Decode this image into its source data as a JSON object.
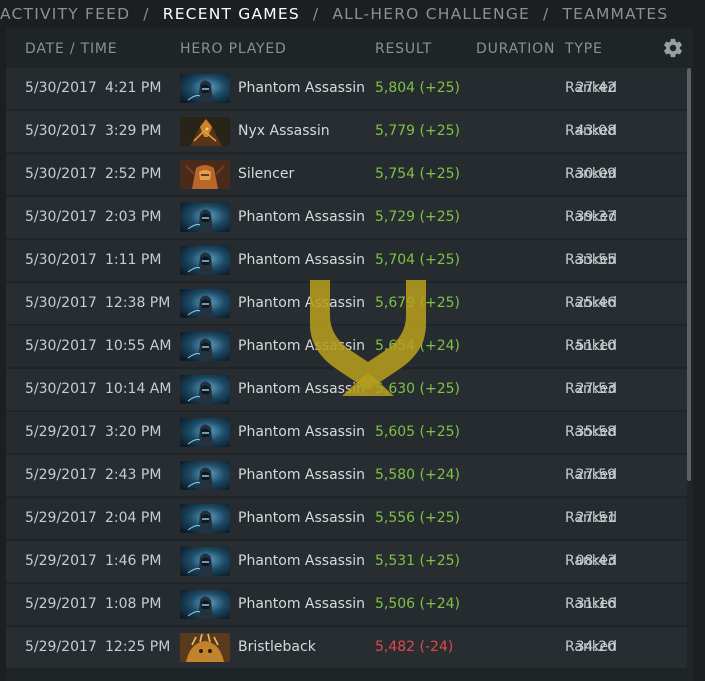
{
  "nav": {
    "tabs": [
      {
        "label": "Activity Feed",
        "active": false
      },
      {
        "label": "Recent Games",
        "active": true
      },
      {
        "label": "All-Hero Challenge",
        "active": false
      },
      {
        "label": "Teammates",
        "active": false
      }
    ],
    "separator": "/"
  },
  "header": {
    "date_time": "DATE / TIME",
    "hero": "HERO PLAYED",
    "result": "RESULT",
    "duration": "DURATION",
    "type": "TYPE",
    "settings_icon": "gear-icon"
  },
  "colors": {
    "win": "#7fc244",
    "loss": "#e04848",
    "watermark": "#b59d1e"
  },
  "games": [
    {
      "date": "5/30/2017",
      "time": "4:21 PM",
      "hero": "Phantom Assassin",
      "icon": "phantom-assassin",
      "result": "5,804 (+25)",
      "outcome": "win",
      "duration": "27:42",
      "type": "Ranked"
    },
    {
      "date": "5/30/2017",
      "time": "3:29 PM",
      "hero": "Nyx Assassin",
      "icon": "nyx-assassin",
      "result": "5,779 (+25)",
      "outcome": "win",
      "duration": "43:08",
      "type": "Ranked"
    },
    {
      "date": "5/30/2017",
      "time": "2:52 PM",
      "hero": "Silencer",
      "icon": "silencer",
      "result": "5,754 (+25)",
      "outcome": "win",
      "duration": "30:09",
      "type": "Ranked"
    },
    {
      "date": "5/30/2017",
      "time": "2:03 PM",
      "hero": "Phantom Assassin",
      "icon": "phantom-assassin",
      "result": "5,729 (+25)",
      "outcome": "win",
      "duration": "39:37",
      "type": "Ranked"
    },
    {
      "date": "5/30/2017",
      "time": "1:11 PM",
      "hero": "Phantom Assassin",
      "icon": "phantom-assassin",
      "result": "5,704 (+25)",
      "outcome": "win",
      "duration": "33:55",
      "type": "Ranked"
    },
    {
      "date": "5/30/2017",
      "time": "12:38 PM",
      "hero": "Phantom Assassin",
      "icon": "phantom-assassin",
      "result": "5,679 (+25)",
      "outcome": "win",
      "duration": "25:46",
      "type": "Ranked"
    },
    {
      "date": "5/30/2017",
      "time": "10:55 AM",
      "hero": "Phantom Assassin",
      "icon": "phantom-assassin",
      "result": "5,654 (+24)",
      "outcome": "win",
      "duration": "51:10",
      "type": "Ranked"
    },
    {
      "date": "5/30/2017",
      "time": "10:14 AM",
      "hero": "Phantom Assassin",
      "icon": "phantom-assassin",
      "result": "5,630 (+25)",
      "outcome": "win",
      "duration": "27:53",
      "type": "Ranked"
    },
    {
      "date": "5/29/2017",
      "time": "3:20 PM",
      "hero": "Phantom Assassin",
      "icon": "phantom-assassin",
      "result": "5,605 (+25)",
      "outcome": "win",
      "duration": "35:58",
      "type": "Ranked"
    },
    {
      "date": "5/29/2017",
      "time": "2:43 PM",
      "hero": "Phantom Assassin",
      "icon": "phantom-assassin",
      "result": "5,580 (+24)",
      "outcome": "win",
      "duration": "27:59",
      "type": "Ranked"
    },
    {
      "date": "5/29/2017",
      "time": "2:04 PM",
      "hero": "Phantom Assassin",
      "icon": "phantom-assassin",
      "result": "5,556 (+25)",
      "outcome": "win",
      "duration": "27:51",
      "type": "Ranked"
    },
    {
      "date": "5/29/2017",
      "time": "1:46 PM",
      "hero": "Phantom Assassin",
      "icon": "phantom-assassin",
      "result": "5,531 (+25)",
      "outcome": "win",
      "duration": "08:43",
      "type": "Ranked"
    },
    {
      "date": "5/29/2017",
      "time": "1:08 PM",
      "hero": "Phantom Assassin",
      "icon": "phantom-assassin",
      "result": "5,506 (+24)",
      "outcome": "win",
      "duration": "31:16",
      "type": "Ranked"
    },
    {
      "date": "5/29/2017",
      "time": "12:25 PM",
      "hero": "Bristleback",
      "icon": "bristleback",
      "result": "5,482 (-24)",
      "outcome": "loss",
      "duration": "34:20",
      "type": "Ranked"
    }
  ]
}
